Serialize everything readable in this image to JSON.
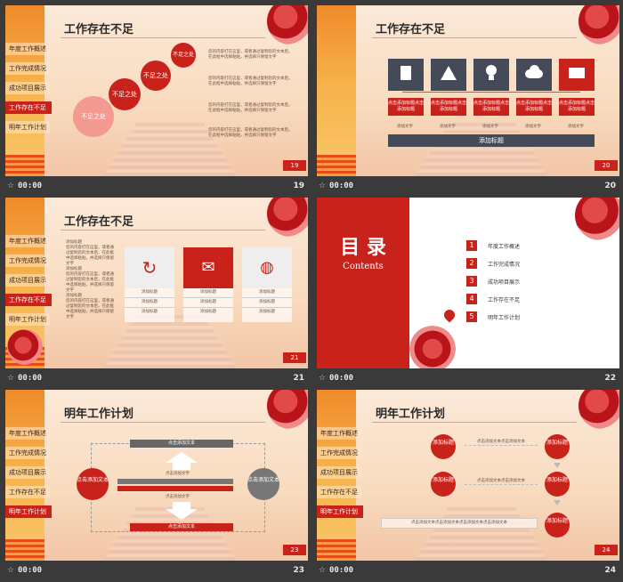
{
  "slides": {
    "s19": {
      "title": "工作存在不足",
      "menu": [
        "年度工作概述",
        "工作完成情况",
        "成功项目展示",
        "工作存在不足",
        "明年工作计划"
      ],
      "bubbles": [
        "不足之处",
        "不足之处",
        "不足之处",
        "不足之处"
      ],
      "notes": [
        "您的内容打在这里，或者通过复制您的文本后，在此框中选择粘贴，并选择只保留文字",
        "您的内容打在这里，或者通过复制您的文本后，在此框中选择粘贴，并选择只保留文字",
        "您的内容打在这里，或者通过复制您的文本后，在此框中选择粘贴，并选择只保留文字",
        "您的内容打在这里，或者通过复制您的文本后，在此框中选择粘贴，并选择只保留文字"
      ],
      "page": "19",
      "time": "00:00",
      "num": "19"
    },
    "s20": {
      "title": "工作存在不足",
      "cards": [
        "点击添加标题点击添加标题",
        "点击添加标题点击添加标题",
        "点击添加标题点击添加标题",
        "点击添加标题点击添加标题",
        "点击添加标题点击添加标题"
      ],
      "captions": [
        "添加文字",
        "添加文字",
        "添加文字",
        "添加文字",
        "添加文字"
      ],
      "icons": [
        "document-icon",
        "warning-icon",
        "bulb-icon",
        "cloud-icon",
        "printer-icon"
      ],
      "bar": "添加标题",
      "page": "20",
      "time": "00:00",
      "num": "20"
    },
    "s21": {
      "title": "工作存在不足",
      "menu": [
        "年度工作概述",
        "工作完成情况",
        "成功项目展示",
        "工作存在不足",
        "明年工作计划"
      ],
      "left_text": [
        "添加标题",
        "您的内容打在这里，或者通过复制您的文本后，在此框中选择粘贴，并选择只保留文字",
        "添加标题",
        "您的内容打在这里，或者通过复制您的文本后，在此框中选择粘贴，并选择只保留文字",
        "添加标题",
        "您的内容打在这里，或者通过复制您的文本后，在此框中选择粘贴，并选择只保留文字"
      ],
      "columns": [
        {
          "head": "添加标题",
          "rows": [
            "添加标题",
            "添加标题",
            "添加标题"
          ]
        },
        {
          "head": "添加标题",
          "rows": [
            "添加标题",
            "添加标题",
            "添加标题"
          ]
        },
        {
          "head": "添加标题",
          "rows": [
            "添加标题",
            "添加标题",
            "添加标题"
          ]
        }
      ],
      "page": "21",
      "time": "00:00",
      "num": "21"
    },
    "s22": {
      "title_cn": "目 录",
      "title_en": "Contents",
      "items": [
        {
          "n": "1",
          "label": "年度工作概述"
        },
        {
          "n": "2",
          "label": "工作完成情况"
        },
        {
          "n": "3",
          "label": "成功项目展示"
        },
        {
          "n": "4",
          "label": "工作存在不足"
        },
        {
          "n": "5",
          "label": "明年工作计划"
        }
      ],
      "page": "22",
      "time": "00:00",
      "num": "22"
    },
    "s23": {
      "title": "明年工作计划",
      "menu": [
        "年度工作概述",
        "工作完成情况",
        "成功项目展示",
        "工作存在不足",
        "明年工作计划"
      ],
      "left_circle": "点击添加文本",
      "right_circle": "点击添加文本",
      "top_bar": "点击添加文本",
      "top_label": "点击添加文字",
      "mid_label": "点击添加文字",
      "bottom_bar": "点击添加文本",
      "page": "23",
      "time": "00:00",
      "num": "23"
    },
    "s24": {
      "title": "明年工作计划",
      "menu": [
        "年度工作概述",
        "工作完成情况",
        "成功项目展示",
        "工作存在不足",
        "明年工作计划"
      ],
      "nodes": [
        "添加标题",
        "添加标题",
        "添加标题",
        "添加标题",
        "添加标题",
        "添加标题"
      ],
      "arrow_text": "点击添加文本点击添加文本",
      "bottom_text": "点击添加文本点击添加文本点击添加文本点击添加文本",
      "page": "24",
      "time": "00:00",
      "num": "24"
    }
  },
  "colors": {
    "accent": "#c9221b",
    "dark": "#454a58",
    "bg": "#3a3a3a"
  },
  "footer_icon": "star-icon"
}
